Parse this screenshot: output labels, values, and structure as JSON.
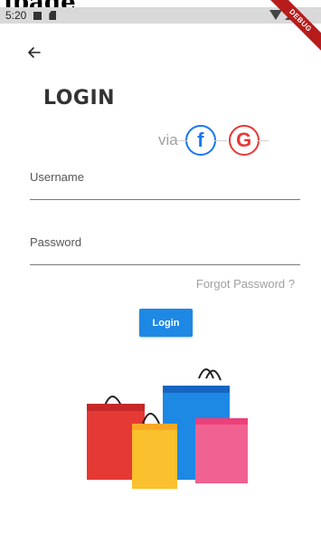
{
  "top_clip_text": "lpage",
  "status_bar": {
    "time": "5:20",
    "left_icons": [
      "notification-icon",
      "sd-card-icon"
    ],
    "right_icons": [
      "wifi-icon",
      "signal-icon"
    ],
    "debug_label": "DEBUG"
  },
  "header": {
    "back_icon": "arrow-back-icon",
    "title": "LOGIN"
  },
  "social": {
    "via_label": "via",
    "facebook_glyph": "f",
    "google_glyph": "G",
    "colors": {
      "facebook": "#1877f2",
      "google": "#e53935"
    }
  },
  "form": {
    "username_label": "Username",
    "username_value": "",
    "password_label": "Password",
    "password_value": "",
    "forgot_password": "Forgot Password ?",
    "login_button": "Login"
  },
  "colors": {
    "accent": "#1e88e5",
    "muted_text": "#a0a0a0"
  },
  "illustration": "shopping-bags-illustration"
}
